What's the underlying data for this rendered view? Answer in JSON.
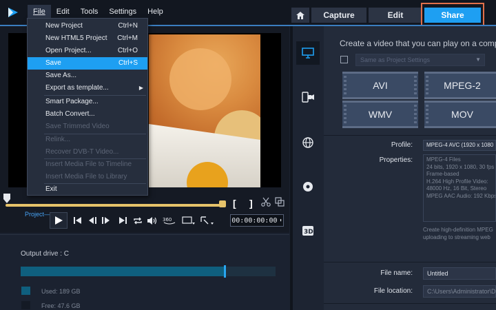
{
  "menubar": [
    {
      "label": "File",
      "active": true
    },
    {
      "label": "Edit"
    },
    {
      "label": "Tools"
    },
    {
      "label": "Settings"
    },
    {
      "label": "Help"
    }
  ],
  "tabs": {
    "capture": "Capture",
    "edit": "Edit",
    "share": "Share"
  },
  "file_menu": [
    {
      "label": "New Project",
      "shortcut": "Ctrl+N",
      "state": "normal"
    },
    {
      "label": "New HTML5 Project",
      "shortcut": "Ctrl+M",
      "state": "normal"
    },
    {
      "label": "Open Project...",
      "shortcut": "Ctrl+O",
      "state": "normal"
    },
    {
      "label": "Save",
      "shortcut": "Ctrl+S",
      "state": "highlighted"
    },
    {
      "label": "Save As...",
      "shortcut": "",
      "state": "normal"
    },
    {
      "label": "Export as template...",
      "shortcut": "",
      "state": "submenu"
    },
    {
      "label": "Smart Package...",
      "shortcut": "",
      "state": "normal"
    },
    {
      "label": "Batch Convert...",
      "shortcut": "",
      "state": "normal"
    },
    {
      "label": "Save Trimmed Video",
      "shortcut": "",
      "state": "disabled"
    },
    {
      "label": "Relink...",
      "shortcut": "",
      "state": "disabled"
    },
    {
      "label": "Recover DVB-T Video...",
      "shortcut": "",
      "state": "disabled"
    },
    {
      "label": "Insert Media File to Timeline",
      "shortcut": "",
      "state": "disabled"
    },
    {
      "label": "Insert Media File to Library",
      "shortcut": "",
      "state": "disabled"
    },
    {
      "label": "Exit",
      "shortcut": "",
      "state": "normal"
    }
  ],
  "player": {
    "project_label": "Project",
    "timecode": "00:00:00:00",
    "bracket_in": "[",
    "bracket_out": "]"
  },
  "drive": {
    "title": "Output drive : C",
    "used_label": "Used:  189 GB",
    "free_label": "Free:  47.6 GB",
    "used_fraction": 0.8,
    "used_color": "#0f5f7e",
    "free_color": "#1e3141",
    "accent": "#2aa6f0"
  },
  "share": {
    "title": "Create a video that you can play on a computer",
    "preset_placeholder": "Same as Project Settings",
    "formats": [
      "AVI",
      "MPEG-2",
      "WMV",
      "MOV"
    ],
    "profile_label": "Profile:",
    "profile_value": "MPEG-4 AVC (1920 x 1080",
    "properties_label": "Properties:",
    "properties_lines": [
      "MPEG-4 Files",
      "24 bits, 1920 x 1080, 30 fps",
      "Frame-based",
      "H.264 High Profile Video:",
      "48000 Hz, 16 Bit, Stereo",
      "MPEG AAC Audio: 192 Kbps"
    ],
    "description_lines": [
      "Create high-definition MPEG",
      "uploading to streaming web"
    ],
    "file_name_label": "File name:",
    "file_name_value": "Untitled",
    "file_location_label": "File location:",
    "file_location_value": "C:\\Users\\Administrator\\Docu"
  },
  "side_icons": [
    "monitor-icon",
    "device-icon",
    "web-icon",
    "disc-icon",
    "3d-icon"
  ],
  "colors": {
    "share_accent": "#1e9ff2",
    "highlight_outline": "#e0704b"
  }
}
